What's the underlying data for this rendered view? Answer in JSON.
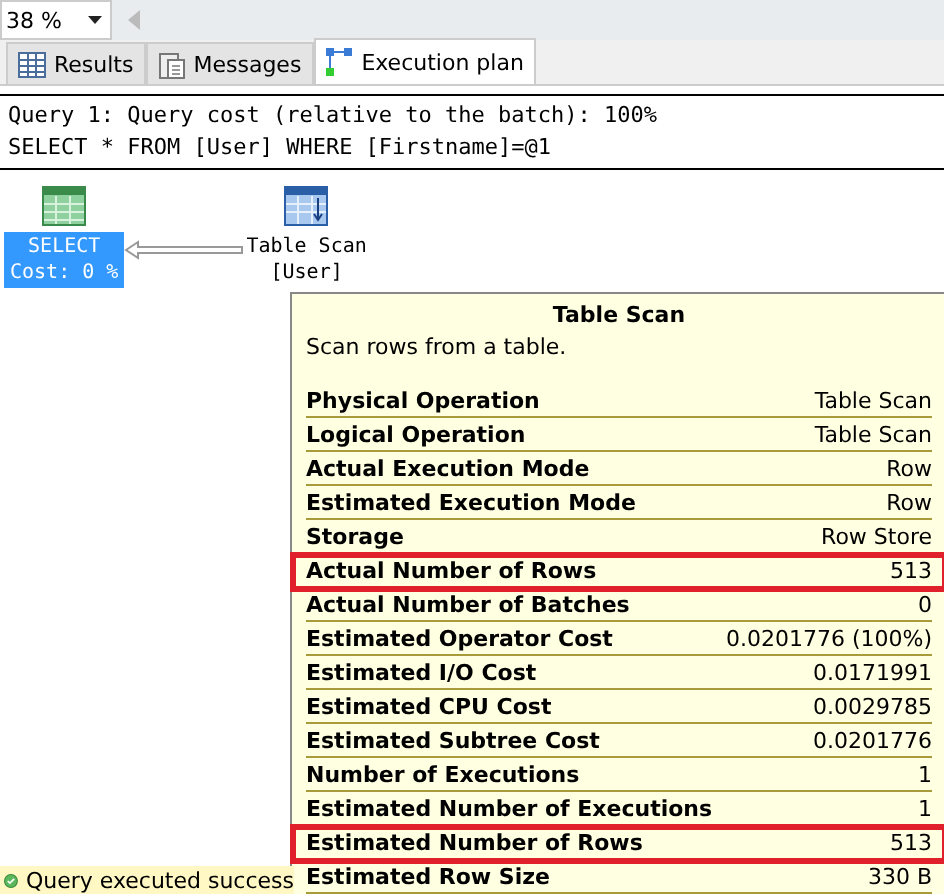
{
  "zoom": {
    "value": "38 %"
  },
  "tabs": [
    {
      "label": "Results",
      "kind": "grid",
      "selected": false
    },
    {
      "label": "Messages",
      "kind": "messages",
      "selected": false
    },
    {
      "label": "Execution plan",
      "kind": "plan",
      "selected": true
    }
  ],
  "query_header": [
    "Query 1: Query cost (relative to the batch): 100%",
    "SELECT * FROM [User] WHERE [Firstname]=@1"
  ],
  "plan": {
    "nodes": [
      {
        "kind": "select",
        "lines": [
          "SELECT",
          "Cost: 0 %"
        ],
        "selected": true
      },
      {
        "kind": "table_scan",
        "lines": [
          "Table Scan",
          "[User]"
        ],
        "selected": false
      }
    ]
  },
  "tooltip": {
    "title": "Table Scan",
    "description": "Scan rows from a table.",
    "rows": [
      {
        "label": "Physical Operation",
        "value": "Table Scan",
        "highlighted": false
      },
      {
        "label": "Logical Operation",
        "value": "Table Scan",
        "highlighted": false
      },
      {
        "label": "Actual Execution Mode",
        "value": "Row",
        "highlighted": false
      },
      {
        "label": "Estimated Execution Mode",
        "value": "Row",
        "highlighted": false
      },
      {
        "label": "Storage",
        "value": "Row Store",
        "highlighted": false
      },
      {
        "label": "Actual Number of Rows",
        "value": "513",
        "highlighted": true
      },
      {
        "label": "Actual Number of Batches",
        "value": "0",
        "highlighted": false
      },
      {
        "label": "Estimated Operator Cost",
        "value": "0.0201776 (100%)",
        "highlighted": false
      },
      {
        "label": "Estimated I/O Cost",
        "value": "0.0171991",
        "highlighted": false
      },
      {
        "label": "Estimated CPU Cost",
        "value": "0.0029785",
        "highlighted": false
      },
      {
        "label": "Estimated Subtree Cost",
        "value": "0.0201776",
        "highlighted": false
      },
      {
        "label": "Number of Executions",
        "value": "1",
        "highlighted": false
      },
      {
        "label": "Estimated Number of Executions",
        "value": "1",
        "highlighted": false
      },
      {
        "label": "Estimated Number of Rows",
        "value": "513",
        "highlighted": true
      },
      {
        "label": "Estimated Row Size",
        "value": "330 B",
        "highlighted": false
      }
    ]
  },
  "status_bar": {
    "text": "Query executed success"
  }
}
